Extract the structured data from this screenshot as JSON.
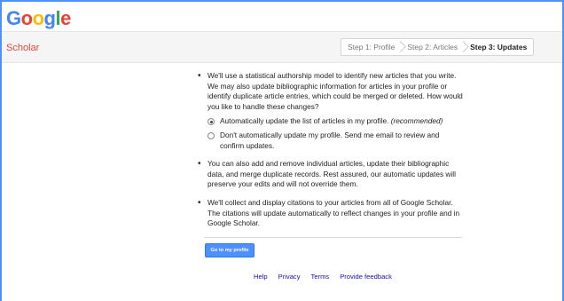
{
  "logo": {
    "letters": [
      "G",
      "o",
      "o",
      "g",
      "l",
      "e"
    ],
    "colors": [
      "#4285f4",
      "#ea4335",
      "#fbbc05",
      "#4285f4",
      "#34a853",
      "#ea4335"
    ]
  },
  "subbar": {
    "scholar": "Scholar"
  },
  "steps": [
    "Step 1: Profile",
    "Step 2: Articles",
    "Step 3: Updates"
  ],
  "content": {
    "bullet1": "We'll use a statistical authorship model to identify new articles that you write. We may also update bibliographic information for articles in your profile or identify duplicate article entries, which could be merged or deleted. How would you like to handle these changes?",
    "option1": "Automatically update the list of articles in my profile.",
    "option1_note": "(recommended)",
    "option2": "Don't automatically update my profile. Send me email to review and confirm updates.",
    "bullet2": "You can also add and remove individual articles, update their bibliographic data, and merge duplicate records. Rest assured, our automatic updates will preserve your edits and will not override them.",
    "bullet3": "We'll collect and display citations to your articles from all of Google Scholar. The citations will update automatically to reflect changes in your profile and in Google Scholar."
  },
  "actions": {
    "primary": "Go to my profile"
  },
  "footer": [
    "Help",
    "Privacy",
    "Terms",
    "Provide feedback"
  ],
  "colors": {
    "accent": "#4d90fe",
    "scholar": "#dd4b39",
    "link": "#1a0dab"
  }
}
